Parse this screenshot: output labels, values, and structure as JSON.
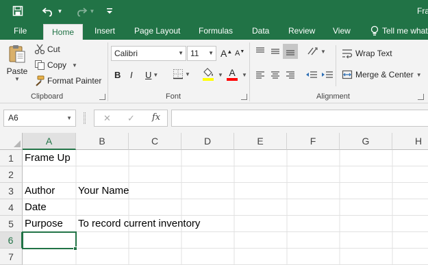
{
  "title_bar": {
    "title": "Fra",
    "save_icon": "save-icon",
    "undo_icon": "undo-icon",
    "redo_icon": "redo-icon",
    "customize_icon": "customize-qat-icon"
  },
  "tabs": [
    {
      "label": "File"
    },
    {
      "label": "Home",
      "active": true
    },
    {
      "label": "Insert"
    },
    {
      "label": "Page Layout"
    },
    {
      "label": "Formulas"
    },
    {
      "label": "Data"
    },
    {
      "label": "Review"
    },
    {
      "label": "View"
    },
    {
      "label": "Tell me what"
    }
  ],
  "ribbon": {
    "clipboard": {
      "label": "Clipboard",
      "paste": "Paste",
      "cut": "Cut",
      "copy": "Copy",
      "format_painter": "Format Painter"
    },
    "font": {
      "label": "Font",
      "font_name": "Calibri",
      "font_size": "11",
      "bold": "B",
      "italic": "I",
      "underline": "U",
      "grow": "A",
      "shrink": "A",
      "font_color_glyph": "A",
      "fill_color": "#ffff00",
      "font_color": "#ff0000"
    },
    "alignment": {
      "label": "Alignment",
      "wrap_text": "Wrap Text",
      "merge_center": "Merge & Center"
    }
  },
  "formula_bar": {
    "name_box": "A6",
    "cancel": "✕",
    "enter": "✓",
    "fx": "fx",
    "formula": ""
  },
  "sheet": {
    "columns": [
      "A",
      "B",
      "C",
      "D",
      "E",
      "F",
      "G",
      "H"
    ],
    "rows": [
      "1",
      "2",
      "3",
      "4",
      "5",
      "6",
      "7"
    ],
    "selected_cell": "A6",
    "cells": {
      "A1": "Frame Up",
      "A3": "Author",
      "B3": "Your Name",
      "A4": "Date",
      "A5": "Purpose",
      "B5": "To record current inventory"
    },
    "accent_color": "#217346"
  }
}
